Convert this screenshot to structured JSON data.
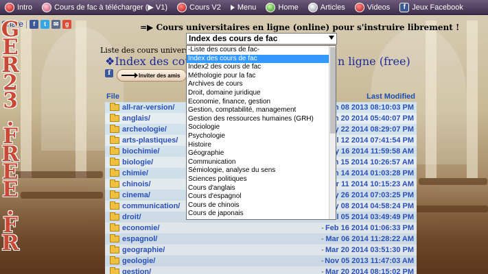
{
  "nav": {
    "items": [
      {
        "label": "Intro",
        "icon": "red-ball-icon"
      },
      {
        "label": "Cours de fac à télécharger (▶ V1)",
        "icon": "pink-ball-icon"
      },
      {
        "label": "Cours V2",
        "icon": "red-ball-icon"
      },
      {
        "label": "Menu",
        "icon": "arrow-icon"
      },
      {
        "label": "Home",
        "icon": "green-home-icon"
      },
      {
        "label": "Articles",
        "icon": "grey-ball-icon"
      },
      {
        "label": "Videos",
        "icon": "red-play-icon"
      },
      {
        "label": "Jeux Facebook",
        "icon": "facebook-icon"
      }
    ]
  },
  "share": {
    "label": "Share"
  },
  "side_title": [
    "G",
    "E",
    "R",
    "2",
    "3",
    ".",
    "F",
    "R",
    "E",
    "E",
    ".",
    "F",
    "R"
  ],
  "header": {
    "prefix": "=▶",
    "text": "Cours universitaires en ligne (online) pour s'instruire librement !"
  },
  "select": {
    "current": "Index des cours de fac",
    "options": [
      "-Liste des cours de fac-",
      "Index des cours de fac",
      "Index2 des cours de fac",
      "Méthologie pour la fac",
      "Archives de cours",
      "Droit, domaine juridique",
      "Economie, finance, gestion",
      "Gestion, comptabilité, management",
      "Gestion des ressources humaines (GRH)",
      "Sociologie",
      "Psychologie",
      "Histoire",
      "Géographie",
      "Communication",
      "Sémiologie, analyse du sens",
      "Sciences politiques",
      "Cours d'anglais",
      "Cours d'espagnol",
      "Cours de chinois",
      "Cours de japonais"
    ],
    "selected_index": 1
  },
  "listing": {
    "subtitle": "Liste des cours universi",
    "title_left": "❖Index des cours",
    "title_right": "n ligne (free)",
    "invite_label": "Inviter des amis"
  },
  "table": {
    "col_file": "File",
    "col_modified": "Last Modified",
    "rows": [
      {
        "name": "all-rar-version/",
        "date": "un 08 2013 08:10:03 PM",
        "dash": ""
      },
      {
        "name": "anglais/",
        "date": "un 20 2014 05:40:07 PM",
        "dash": ""
      },
      {
        "name": "archeologie/",
        "date": "ay 22 2014 08:29:07 PM",
        "dash": ""
      },
      {
        "name": "arts-plastiques/",
        "date": "Jul 12 2014 07:41:54 PM",
        "dash": ""
      },
      {
        "name": "biochimie/",
        "date": "ay 16 2014 11:59:58 AM",
        "dash": ""
      },
      {
        "name": "biologie/",
        "date": "un 15 2014 10:26:57 AM",
        "dash": ""
      },
      {
        "name": "chimie/",
        "date": "un 14 2014 01:03:28 PM",
        "dash": ""
      },
      {
        "name": "chinois/",
        "date": "ar 11 2014 10:15:23 AM",
        "dash": ""
      },
      {
        "name": "cinema/",
        "date": "ay 26 2014 07:03:25 PM",
        "dash": ""
      },
      {
        "name": "communication/",
        "date": "ay 08 2014 04:58:24 PM",
        "dash": ""
      },
      {
        "name": "droit/",
        "date": "Jul 05 2014 03:49:49 PM",
        "dash": ""
      },
      {
        "name": "economie/",
        "date": "Feb 16 2014 01:06:33 PM",
        "dash": "-"
      },
      {
        "name": "espagnol/",
        "date": "Mar 06 2014 11:28:22 AM",
        "dash": "-"
      },
      {
        "name": "geographie/",
        "date": "Mar 20 2014 03:51:30 PM",
        "dash": "-"
      },
      {
        "name": "geologie/",
        "date": "Nov 05 2013 11:47:03 AM",
        "dash": "-"
      },
      {
        "name": "gestion/",
        "date": "Mar 20 2014 08:15:02 PM",
        "dash": "-"
      }
    ]
  },
  "colors": {
    "nav_bg": "#4a3a58",
    "side_title": "#c84a36",
    "link": "#2a50b8",
    "select_highlight": "#3399ff"
  }
}
